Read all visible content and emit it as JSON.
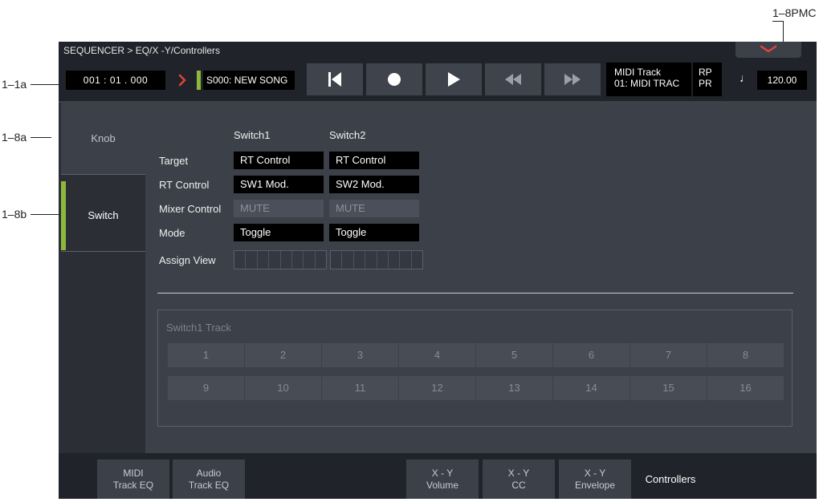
{
  "callouts": {
    "pmc": "1–8PMC",
    "a1": "1–1a",
    "a8": "1–8a",
    "b8": "1–8b"
  },
  "titlebar": {
    "breadcrumb": "SEQUENCER > EQ/X -Y/Controllers"
  },
  "transport": {
    "location": "001 : 01 . 000",
    "song": "S000: NEW SONG",
    "track_line1": "MIDI Track",
    "track_line2": "01: MIDI TRAC",
    "rp": "RP",
    "pr": "PR",
    "note_glyph": "♩",
    "tempo": "120.00",
    "buttons": [
      "skip-to-start-icon",
      "record-icon",
      "play-icon",
      "rewind-icon",
      "fast-forward-icon"
    ]
  },
  "nav": {
    "knob": "Knob",
    "switch": "Switch"
  },
  "params": {
    "col1": "Switch1",
    "col2": "Switch2",
    "labels": {
      "target": "Target",
      "rt_control": "RT Control",
      "mixer_control": "Mixer Control",
      "mode": "Mode",
      "assign_view": "Assign View"
    },
    "switch1": {
      "target": "RT Control",
      "rt_control": "SW1 Mod.",
      "mixer_control": "MUTE",
      "mode": "Toggle"
    },
    "switch2": {
      "target": "RT Control",
      "rt_control": "SW2 Mod.",
      "mixer_control": "MUTE",
      "mode": "Toggle"
    }
  },
  "tracks": {
    "title": "Switch1 Track",
    "row1": [
      "1",
      "2",
      "3",
      "4",
      "5",
      "6",
      "7",
      "8"
    ],
    "row2": [
      "9",
      "10",
      "11",
      "12",
      "13",
      "14",
      "15",
      "16"
    ]
  },
  "bottom_tabs": {
    "midi_eq_1": "MIDI",
    "midi_eq_2": "Track EQ",
    "audio_eq_1": "Audio",
    "audio_eq_2": "Track EQ",
    "xy_vol_1": "X - Y",
    "xy_vol_2": "Volume",
    "xy_cc_1": "X - Y",
    "xy_cc_2": "CC",
    "xy_env_1": "X - Y",
    "xy_env_2": "Envelope",
    "controllers": "Controllers"
  },
  "colors": {
    "accent_green": "#8db83c",
    "song_red": "#e0443a"
  }
}
